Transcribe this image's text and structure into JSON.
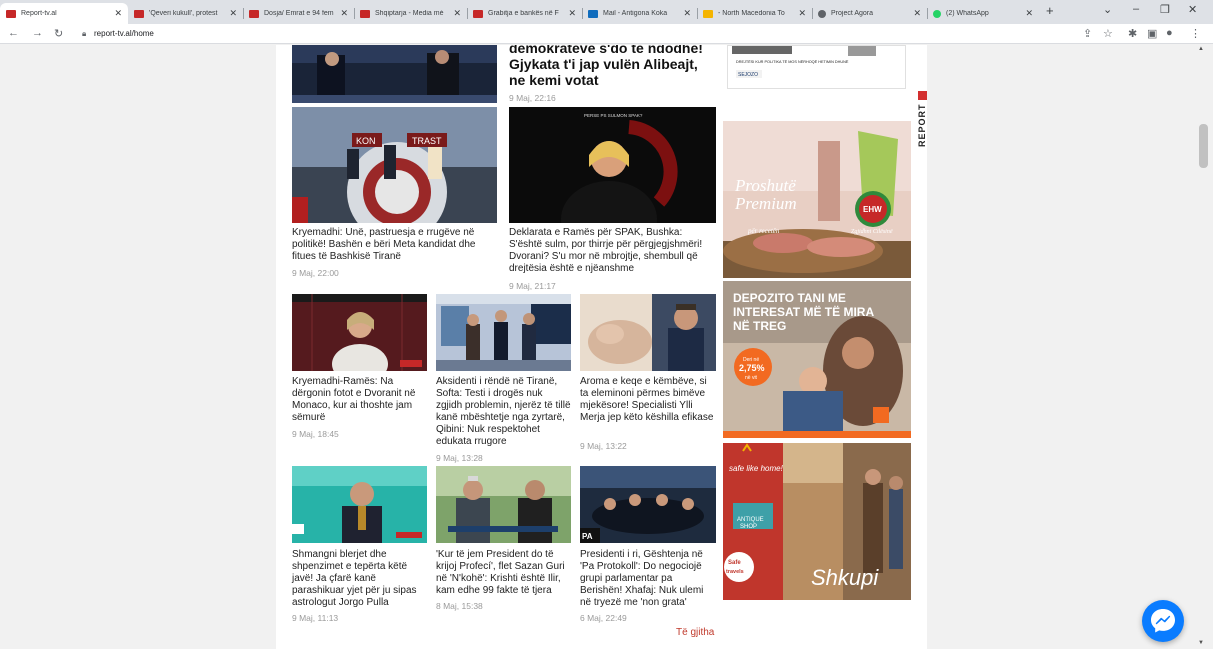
{
  "browser": {
    "tabs": [
      {
        "title": "Report-tv.al",
        "fav": "#c62828",
        "active": true
      },
      {
        "title": "'Qeveri kukull', protest",
        "fav": "#c62828"
      },
      {
        "title": "Dosja/ Emrat e 94 fem",
        "fav": "#c62828"
      },
      {
        "title": "Shqiptarja - Media mé",
        "fav": "#c62828"
      },
      {
        "title": "Grabitja e bankës në F",
        "fav": "#c62828"
      },
      {
        "title": "Mail - Antigona Koka",
        "fav": "#0f6cbd"
      },
      {
        "title": "- North Macedonia To",
        "fav": "#f4b400"
      },
      {
        "title": "Project Agora",
        "fav": "#5f6368"
      },
      {
        "title": "(2) WhatsApp",
        "fav": "#25d366"
      }
    ],
    "url": "report-tv.al/home"
  },
  "articles": {
    "top_feature": {
      "headline": "demokratëve s'do të ndodhë! Gjykata t'i jap vulën Alibeajt, ne kemi votat",
      "date": "9 Maj, 22:16"
    },
    "row1": [
      {
        "headline": "Kryemadhi: Unë, pastruesja e rrugëve në politikë! Bashën e bëri Meta kandidat dhe fitues të Bashkisë Tiranë",
        "date": "9 Maj, 22:00",
        "thumb_caption": "KON TRAST"
      },
      {
        "headline": "Deklarata e Ramës për SPAK, Bushka: S'është sulm, por thirrje për përgjegjshmëri! Dvorani? S'u mor në mbrojtje, shembull që drejtësia është e njëanshme",
        "date": "9 Maj, 21:17",
        "thumb_caption": "PERSE PS SULMON SPAK?"
      }
    ],
    "row2": [
      {
        "headline": "Kryemadhi-Ramës: Na dërgonin fotot e Dvoranit në Monaco, kur ai thoshte jam sëmurë",
        "date": "9 Maj, 18:45"
      },
      {
        "headline": "Aksidenti i rëndë në Tiranë, Softa: Testi i drogës nuk zgjidh problemin, njerëz të tillë kanë mbështetje nga zyrtarë, Qibini: Nuk respektohet edukata rrugore",
        "date": "9 Maj, 13:28"
      },
      {
        "headline": "Aroma e keqe e këmbëve, si ta eleminoni përmes bimëve mjekësore! Specialisti Ylli Merja jep këto këshilla efikase",
        "date": "9 Maj, 13:22"
      }
    ],
    "row3": [
      {
        "headline": "Shmangni blerjet dhe shpenzimet e tepërta këtë javë! Ja çfarë kanë parashikuar yjet për ju sipas astrologut Jorgo Pulla",
        "date": "9 Maj, 11:13"
      },
      {
        "headline": "'Kur të jem President do të krijoj Profecí', flet Sazan Guri në 'N'kohë': Krishti është Ilir, kam edhe 99 fakte të tjera",
        "date": "8 Maj, 15:38"
      },
      {
        "headline": "Presidenti i ri, Gështenja në 'Pa Protokoll': Do negociojë grupi parlamentar pa Berishën! Xhafaj: Nuk ulemi në tryezë me 'non grata'",
        "date": "6 Maj, 22:49"
      }
    ],
    "all_link": "Të gjitha"
  },
  "sidebar": {
    "vertical_label": "REPORT",
    "ad_top_text": "DREJTËSI KUR POLITIKA TË MOS NËRHOQË HETIMIN DHUNË",
    "ad_top_logo": "SEJOZO",
    "ad1": {
      "line1": "Proshutë",
      "line2": "Premium",
      "sub": "për recetën",
      "badge": "EHW",
      "slogan": "Zgjidhni Cilësinë"
    },
    "ad2": {
      "title": "DEPOZITO TANI ME INTERESAT MË TË MIRA NË TREG",
      "rate": "2,75%",
      "rate_pre": "Deri në",
      "rate_post": "në vit"
    },
    "ad3": {
      "safe": "safe like home!",
      "shop1": "ANTIQUE",
      "shop2": "SHOP",
      "travels1": "Safe",
      "travels2": "travels",
      "city": "Shkupi"
    }
  },
  "colors": {
    "accent_red": "#c0392b",
    "bank_orange": "#f26a21",
    "messenger_blue": "#0a7cff"
  },
  "icons": [
    "back-icon",
    "forward-icon",
    "reload-icon",
    "lock-icon",
    "share-icon",
    "star-icon",
    "extensions-icon",
    "sidepanel-icon",
    "profile-icon",
    "menu-icon",
    "messenger-icon"
  ]
}
